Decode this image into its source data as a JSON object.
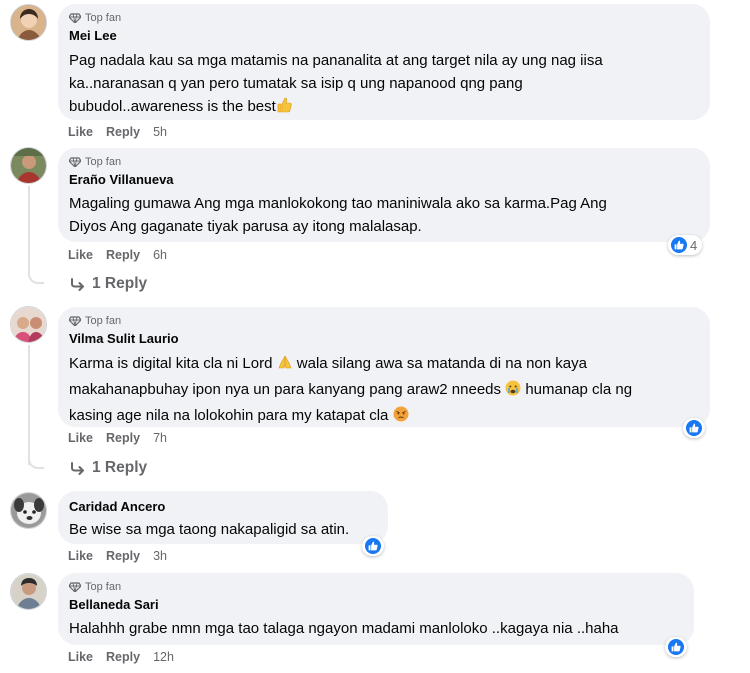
{
  "comments": [
    {
      "badge": "Top fan",
      "author": "Mei Lee",
      "lines": [
        "Pag nadala kau sa mga matamis na pananalita at ang target nila ay ung nag iisa",
        "ka..naranasan q yan pero tumatak sa isip q ung napanood qng pang",
        "bubudol..awareness is the best"
      ],
      "actions": {
        "like": "Like",
        "reply": "Reply",
        "time": "5h"
      },
      "emoji": [
        "thumbs-up-emoji"
      ]
    },
    {
      "badge": "Top fan",
      "author": "Eraño Villanueva",
      "lines": [
        "Magaling gumawa Ang mga manlokokong tao maniniwala ako sa karma.Pag Ang",
        "Diyos Ang gaganate tiyak parusa ay itong malalasap."
      ],
      "actions": {
        "like": "Like",
        "reply": "Reply",
        "time": "6h"
      },
      "reaction_count": "4",
      "replies": "1 Reply"
    },
    {
      "badge": "Top fan",
      "author": "Vilma Sulit Laurio",
      "lines": [
        "Karma is digital kita cla ni Lord",
        "wala silang awa sa matanda di na non kaya",
        "makahanapbuhay ipon nya un para kanyang pang araw2 nneeds",
        "humanap cla ng",
        "kasing age nila na lolokohin para my katapat cla"
      ],
      "actions": {
        "like": "Like",
        "reply": "Reply",
        "time": "7h"
      },
      "replies": "1 Reply",
      "emoji": [
        "folded-hands-emoji",
        "crying-face-emoji",
        "angry-face-emoji"
      ]
    },
    {
      "author": "Caridad Ancero",
      "lines": [
        "Be wise sa mga taong nakapaligid sa atin."
      ],
      "actions": {
        "like": "Like",
        "reply": "Reply",
        "time": "3h"
      }
    },
    {
      "badge": "Top fan",
      "author": "Bellaneda Sari",
      "lines": [
        "Halahhh grabe nmn mga tao talaga ngayon madami manloloko ..kagaya nia ..haha"
      ],
      "actions": {
        "like": "Like",
        "reply": "Reply",
        "time": "12h"
      }
    }
  ],
  "colors": {
    "bubble": "#f0f2f5",
    "muted": "#65676b",
    "like_blue": "#1877f2"
  }
}
